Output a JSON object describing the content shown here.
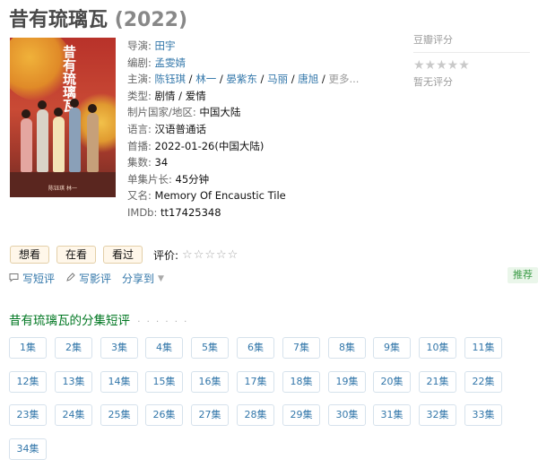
{
  "title": {
    "name": "昔有琉璃瓦",
    "year": "(2022)"
  },
  "poster": {
    "title_text": "昔有琉璃瓦",
    "credits": "陈钰琪 林一"
  },
  "info": {
    "director_label": "导演:",
    "director": "田宇",
    "writer_label": "编剧:",
    "writer": "孟雯婧",
    "cast_label": "主演:",
    "cast": [
      "陈钰琪",
      "林一",
      "晏紫东",
      "马丽",
      "唐旭"
    ],
    "cast_more": "更多...",
    "genre_label": "类型:",
    "genre": [
      "剧情",
      "爱情"
    ],
    "region_label": "制片国家/地区:",
    "region": "中国大陆",
    "language_label": "语言:",
    "language": "汉语普通话",
    "premiere_label": "首播:",
    "premiere": "2022-01-26(中国大陆)",
    "episodes_label": "集数:",
    "episodes": "34",
    "runtime_label": "单集片长:",
    "runtime": "45分钟",
    "aka_label": "又名:",
    "aka": "Memory Of Encaustic Tile",
    "imdb_label": "IMDb:",
    "imdb": "tt17425348"
  },
  "rating": {
    "label": "豆瓣评分",
    "stars": "★★★★★",
    "no_rating": "暂无评分"
  },
  "actions": {
    "want": "想看",
    "watching": "在看",
    "watched": "看过",
    "rate_label": "评价:",
    "rate_stars": "☆☆☆☆☆"
  },
  "links": {
    "short_review": "写短评",
    "review": "写影评",
    "share": "分享到"
  },
  "recommend": "推荐",
  "episodes_section": {
    "title": "昔有琉璃瓦的分集短评",
    "dots": "· · · · · ·"
  },
  "episode_buttons": [
    "1集",
    "2集",
    "3集",
    "4集",
    "5集",
    "6集",
    "7集",
    "8集",
    "9集",
    "10集",
    "11集",
    "12集",
    "13集",
    "14集",
    "15集",
    "16集",
    "17集",
    "18集",
    "19集",
    "20集",
    "21集",
    "22集",
    "23集",
    "24集",
    "25集",
    "26集",
    "27集",
    "28集",
    "29集",
    "30集",
    "31集",
    "32集",
    "33集",
    "34集"
  ],
  "colors": {
    "link": "#3377aa",
    "section_green": "#007722",
    "button_bg": "#fff7ea",
    "button_border": "#e3cfa8"
  }
}
